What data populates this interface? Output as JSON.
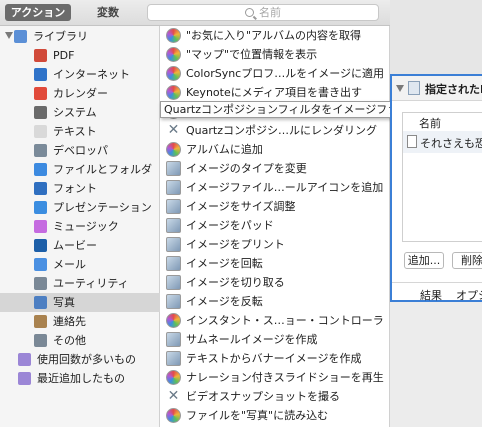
{
  "toolbar": {
    "actions_tab": "アクション",
    "variables_tab": "変数",
    "search_placeholder": "名前"
  },
  "library": {
    "items": [
      {
        "label": "ライブラリ",
        "icon": "folder-icon",
        "color": "#5b8fd6"
      },
      {
        "label": "PDF",
        "icon": "pdf-icon",
        "color": "#d14a3a"
      },
      {
        "label": "インターネット",
        "icon": "globe-icon",
        "color": "#2f73c9"
      },
      {
        "label": "カレンダー",
        "icon": "calendar-icon",
        "color": "#e14a3a"
      },
      {
        "label": "システム",
        "icon": "system-icon",
        "color": "#6a6a6a"
      },
      {
        "label": "テキスト",
        "icon": "text-icon",
        "color": "#d9d9d9"
      },
      {
        "label": "デベロッパ",
        "icon": "tools-icon",
        "color": "#7a8a99"
      },
      {
        "label": "ファイルとフォルダ",
        "icon": "finder-icon",
        "color": "#3c8ae0"
      },
      {
        "label": "フォント",
        "icon": "font-icon",
        "color": "#2f6fc0"
      },
      {
        "label": "プレゼンテーション",
        "icon": "keynote-icon",
        "color": "#3b8de0"
      },
      {
        "label": "ミュージック",
        "icon": "music-icon",
        "color": "#c56be0"
      },
      {
        "label": "ムービー",
        "icon": "movie-icon",
        "color": "#1d5fa8"
      },
      {
        "label": "メール",
        "icon": "mail-icon",
        "color": "#4a90e2"
      },
      {
        "label": "ユーティリティ",
        "icon": "utility-icon",
        "color": "#7a8896"
      },
      {
        "label": "写真",
        "icon": "photo-icon",
        "color": "#4d7fc2"
      },
      {
        "label": "連絡先",
        "icon": "contacts-icon",
        "color": "#a9824f"
      },
      {
        "label": "その他",
        "icon": "other-icon",
        "color": "#7a8896"
      },
      {
        "label": "使用回数が多いもの",
        "icon": "smart-folder-icon",
        "color": "#9b86d6"
      },
      {
        "label": "最近追加したもの",
        "icon": "smart-folder-icon",
        "color": "#9b86d6"
      }
    ],
    "selected_index": 14
  },
  "actions": {
    "items": [
      {
        "label": "\"お気に入り\"アルバムの内容を取得",
        "icon": "photos-action-icon"
      },
      {
        "label": "\"マップ\"で位置情報を表示",
        "icon": "photos-action-icon"
      },
      {
        "label": "ColorSyncプロフ…ルをイメージに適用",
        "icon": "photos-action-icon"
      },
      {
        "label": "Keynoteにメディア項目を書き出す",
        "icon": "photos-action-icon"
      },
      {
        "label": "Quartzコンポジションフィルタをイメージファイルに適用",
        "icon": "photos-action-icon"
      },
      {
        "label": "Quartzコンポジシ…ルにレンダリング",
        "icon": "cross-tools-icon"
      },
      {
        "label": "アルバムに追加",
        "icon": "photos-action-icon"
      },
      {
        "label": "イメージのタイプを変更",
        "icon": "image-tool-icon"
      },
      {
        "label": "イメージファイル…ールアイコンを追加",
        "icon": "image-tool-icon"
      },
      {
        "label": "イメージをサイズ調整",
        "icon": "image-tool-icon"
      },
      {
        "label": "イメージをパッド",
        "icon": "image-tool-icon"
      },
      {
        "label": "イメージをプリント",
        "icon": "image-tool-icon"
      },
      {
        "label": "イメージを回転",
        "icon": "image-tool-icon"
      },
      {
        "label": "イメージを切り取る",
        "icon": "image-tool-icon"
      },
      {
        "label": "イメージを反転",
        "icon": "image-tool-icon"
      },
      {
        "label": "インスタント・ス…ョー・コントローラ",
        "icon": "photos-action-icon"
      },
      {
        "label": "サムネールイメージを作成",
        "icon": "image-tool-icon"
      },
      {
        "label": "テキストからバナーイメージを作成",
        "icon": "image-tool-icon"
      },
      {
        "label": "ナレーション付きスライドショーを再生",
        "icon": "photos-action-icon"
      },
      {
        "label": "ビデオスナップショットを撮る",
        "icon": "cross-tools-icon"
      },
      {
        "label": "ファイルを\"写真\"に読み込む",
        "icon": "photos-action-icon"
      }
    ],
    "tooltip": "Quartzコンポジションフィルタをイメージファイルに適用"
  },
  "workflow": {
    "title": "指定されたFi",
    "column_header": "名前",
    "file_row": "それさえも恐",
    "add_button": "追加...",
    "delete_button": "削除",
    "results_tab": "結果",
    "options_tab": "オプショ"
  },
  "colors": {
    "accent": "#3b7fd6",
    "selection": "#d6d6d6"
  }
}
